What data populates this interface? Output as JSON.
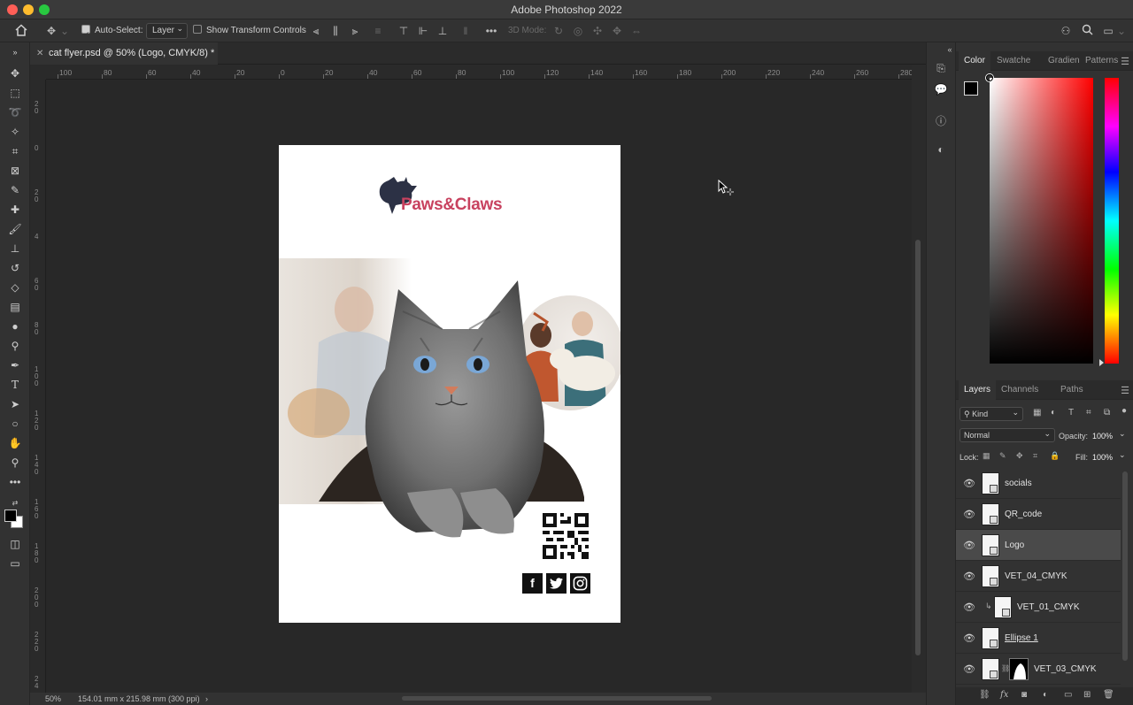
{
  "window": {
    "title": "Adobe Photoshop 2022"
  },
  "options_bar": {
    "auto_select_label": "Auto-Select:",
    "auto_select_checked": true,
    "layer_dropdown": "Layer",
    "show_transform_label": "Show Transform Controls",
    "mode_3d_label": "3D Mode:"
  },
  "document": {
    "tab_title": "cat flyer.psd @ 50% (Logo, CMYK/8) *",
    "brand_name": "Paws&Claws",
    "brand_color": "#c8425f",
    "social_labels": {
      "facebook": "f"
    }
  },
  "rulers": {
    "horizontal": [
      "100",
      "80",
      "60",
      "40",
      "20",
      "0",
      "20",
      "40",
      "60",
      "80",
      "100",
      "120",
      "140",
      "160",
      "180",
      "200",
      "220",
      "240",
      "260",
      "280"
    ],
    "vertical": [
      "2\n0",
      "0",
      "2\n0",
      "4",
      "6\n0",
      "8\n0",
      "1\n0\n0",
      "1\n2\n0",
      "1\n4\n0",
      "1\n6\n0",
      "1\n8\n0",
      "2\n0\n0",
      "2\n2\n0",
      "2\n4"
    ]
  },
  "status": {
    "zoom": "50%",
    "doc_size": "154.01 mm x 215.98 mm (300 ppi)"
  },
  "color_panel": {
    "tabs": [
      "Color",
      "Swatche",
      "Gradien",
      "Patterns"
    ],
    "active_tab": "Color",
    "foreground": "#000000",
    "background": "#ffffff"
  },
  "layers_panel": {
    "tabs": [
      "Layers",
      "Channels",
      "Paths"
    ],
    "active_tab": "Layers",
    "filter_kind": "Kind",
    "blend_mode": "Normal",
    "opacity_label": "Opacity:",
    "opacity_value": "100%",
    "lock_label": "Lock:",
    "fill_label": "Fill:",
    "fill_value": "100%",
    "layers": [
      {
        "name": "socials",
        "selected": false
      },
      {
        "name": "QR_code",
        "selected": false
      },
      {
        "name": "Logo",
        "selected": true
      },
      {
        "name": "VET_04_CMYK",
        "selected": false
      },
      {
        "name": "VET_01_CMYK",
        "selected": false
      },
      {
        "name": "Ellipse 1",
        "selected": false
      },
      {
        "name": "VET_03_CMYK",
        "selected": false
      }
    ],
    "footer_fx": "fx"
  }
}
